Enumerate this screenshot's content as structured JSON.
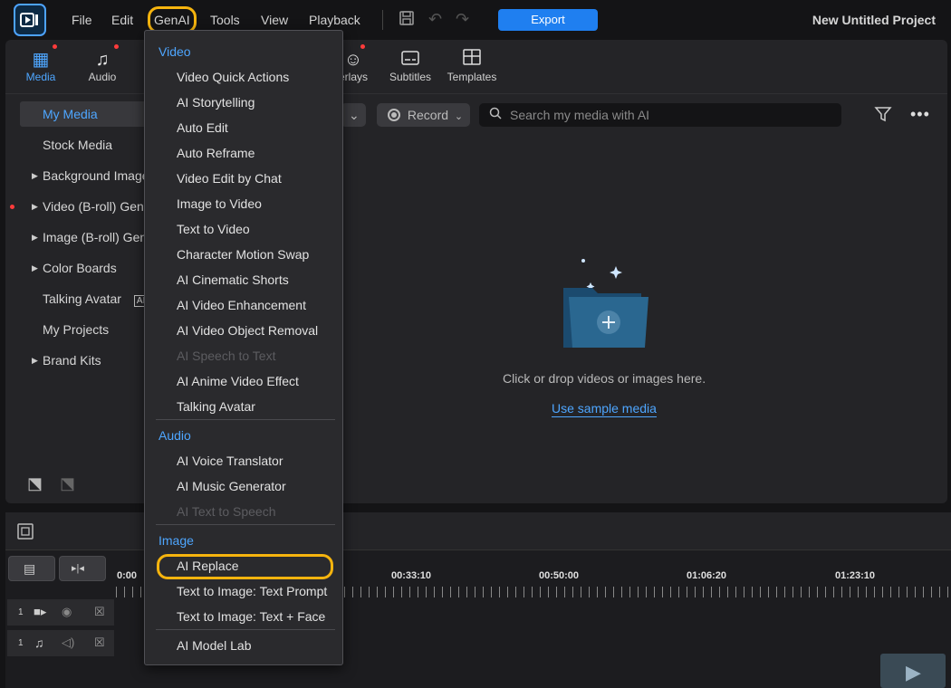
{
  "topbar": {
    "menu": [
      "File",
      "Edit",
      "GenAI",
      "Tools",
      "View",
      "Playback"
    ],
    "export_label": "Export",
    "project_title": "New Untitled Project"
  },
  "rooms": [
    {
      "label": "Media",
      "icon": "media-icon"
    },
    {
      "label": "Audio",
      "icon": "music-note-icon"
    },
    {
      "label": "erlays",
      "icon": "sticker-icon"
    },
    {
      "label": "Subtitles",
      "icon": "subtitles-icon"
    },
    {
      "label": "Templates",
      "icon": "templates-icon"
    }
  ],
  "sidebar": {
    "items": [
      {
        "label": "My Media"
      },
      {
        "label": "Stock Media"
      },
      {
        "label": "Background Image"
      },
      {
        "label": "Video (B-roll) Gene"
      },
      {
        "label": "Image (B-roll) Gen"
      },
      {
        "label": "Color Boards"
      },
      {
        "label": "Talking Avatar"
      },
      {
        "label": "My Projects"
      },
      {
        "label": "Brand Kits"
      }
    ]
  },
  "media": {
    "record_label": "Record",
    "search_placeholder": "Search my media with AI",
    "empty_text": "Click or drop videos or images here.",
    "sample_link": "Use sample media"
  },
  "timeline": {
    "times": [
      "0:00",
      "00:33:10",
      "00:50:00",
      "01:06:20",
      "01:23:10"
    ],
    "track_numbers": [
      "1",
      "1"
    ]
  },
  "genai_menu": {
    "video_header": "Video",
    "video_items": [
      {
        "label": "Video Quick Actions"
      },
      {
        "label": "AI Storytelling"
      },
      {
        "label": "Auto Edit"
      },
      {
        "label": "Auto Reframe"
      },
      {
        "label": "Video Edit by Chat"
      },
      {
        "label": "Image to Video"
      },
      {
        "label": "Text to Video"
      },
      {
        "label": "Character Motion Swap"
      },
      {
        "label": "AI Cinematic Shorts"
      },
      {
        "label": "AI Video Enhancement"
      },
      {
        "label": "AI Video Object Removal"
      },
      {
        "label": "AI Speech to Text"
      },
      {
        "label": "AI Anime Video Effect"
      },
      {
        "label": "Talking Avatar"
      }
    ],
    "audio_header": "Audio",
    "audio_items": [
      {
        "label": "AI Voice Translator"
      },
      {
        "label": "AI Music Generator"
      },
      {
        "label": "AI Text to Speech"
      }
    ],
    "image_header": "Image",
    "image_items": [
      {
        "label": "AI Replace"
      },
      {
        "label": "Text to Image: Text Prompt"
      },
      {
        "label": "Text to Image: Text + Face"
      }
    ],
    "model_lab": "AI Model Lab"
  },
  "colors": {
    "accent": "#4ea6ff",
    "export": "#1f7ff0",
    "highlight_ring": "#f6b40e"
  }
}
